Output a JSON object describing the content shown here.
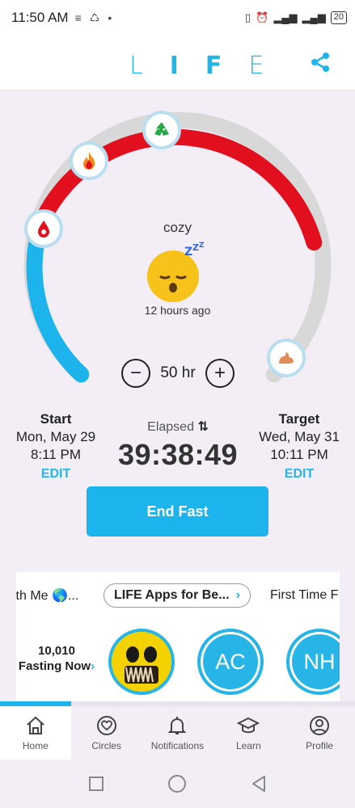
{
  "status_bar": {
    "time": "11:50 AM",
    "battery": "20"
  },
  "header": {
    "logo_letters": [
      "L",
      "I",
      "F",
      "E"
    ]
  },
  "timer": {
    "mood": "cozy",
    "mood_ago": "12 hours ago",
    "goal_hours": "50 hr",
    "progress_fraction": 0.79,
    "start": {
      "title": "Start",
      "date": "Mon, May 29",
      "time": "8:11 PM",
      "edit": "EDIT"
    },
    "target": {
      "title": "Target",
      "date": "Wed, May 31",
      "time": "10:11 PM",
      "edit": "EDIT"
    },
    "elapsed_label": "Elapsed",
    "elapsed_time": "39:38:49",
    "end_button": "End Fast",
    "badge_icons": [
      "blood-drop-icon",
      "fire-icon",
      "recycle-icon",
      "muscle-icon"
    ]
  },
  "circles": {
    "chips": [
      "ith Me 🌎...",
      "LIFE Apps for Be...",
      "First Time F"
    ],
    "fasting_count": "10,010",
    "fasting_now": "Fasting Now",
    "avatars": [
      "AC",
      "NH"
    ]
  },
  "tabs": [
    {
      "label": "Home",
      "icon": "home-icon"
    },
    {
      "label": "Circles",
      "icon": "circles-icon"
    },
    {
      "label": "Notifications",
      "icon": "bell-icon"
    },
    {
      "label": "Learn",
      "icon": "graduation-cap-icon"
    },
    {
      "label": "Profile",
      "icon": "profile-icon"
    }
  ],
  "colors": {
    "accent": "#1db4ed",
    "ring_red": "#e2101f",
    "ring_gray": "#d8d8d8"
  }
}
